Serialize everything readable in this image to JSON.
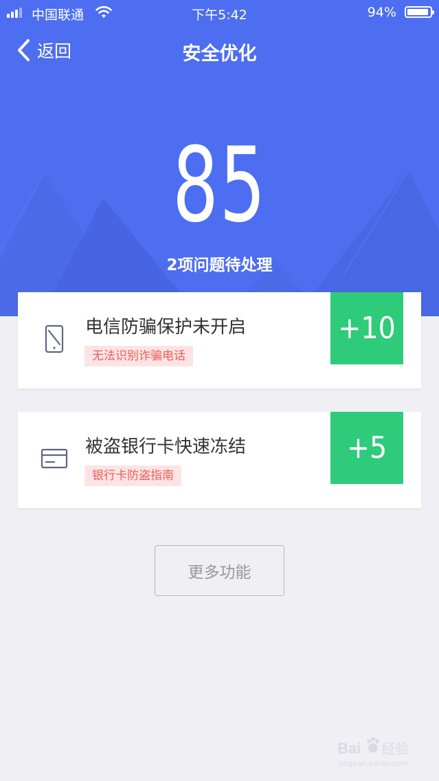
{
  "status_bar": {
    "carrier": "中国联通",
    "time": "下午5:42",
    "battery": "94%",
    "battery_level": 0.94
  },
  "nav": {
    "back_label": "返回",
    "title": "安全优化"
  },
  "hero": {
    "score": "85",
    "subtitle": "2项问题待处理"
  },
  "issues": [
    {
      "title": "电信防骗保护未开启",
      "tag": "无法识别诈骗电话",
      "points": "+10",
      "icon": "phone-blocked-icon"
    },
    {
      "title": "被盗银行卡快速冻结",
      "tag": "银行卡防盗指南",
      "points": "+5",
      "icon": "bank-card-icon"
    }
  ],
  "more_button": "更多功能",
  "watermark": {
    "brand": "Bai",
    "brand_suffix": "经验",
    "url": "jingyan.baidu.com"
  },
  "colors": {
    "primary_blue": "#4d6ef0",
    "points_green": "#2ecb7b",
    "tag_red": "#ee5b5b",
    "tag_bg": "#fde4e4",
    "page_bg": "#efeff4"
  }
}
